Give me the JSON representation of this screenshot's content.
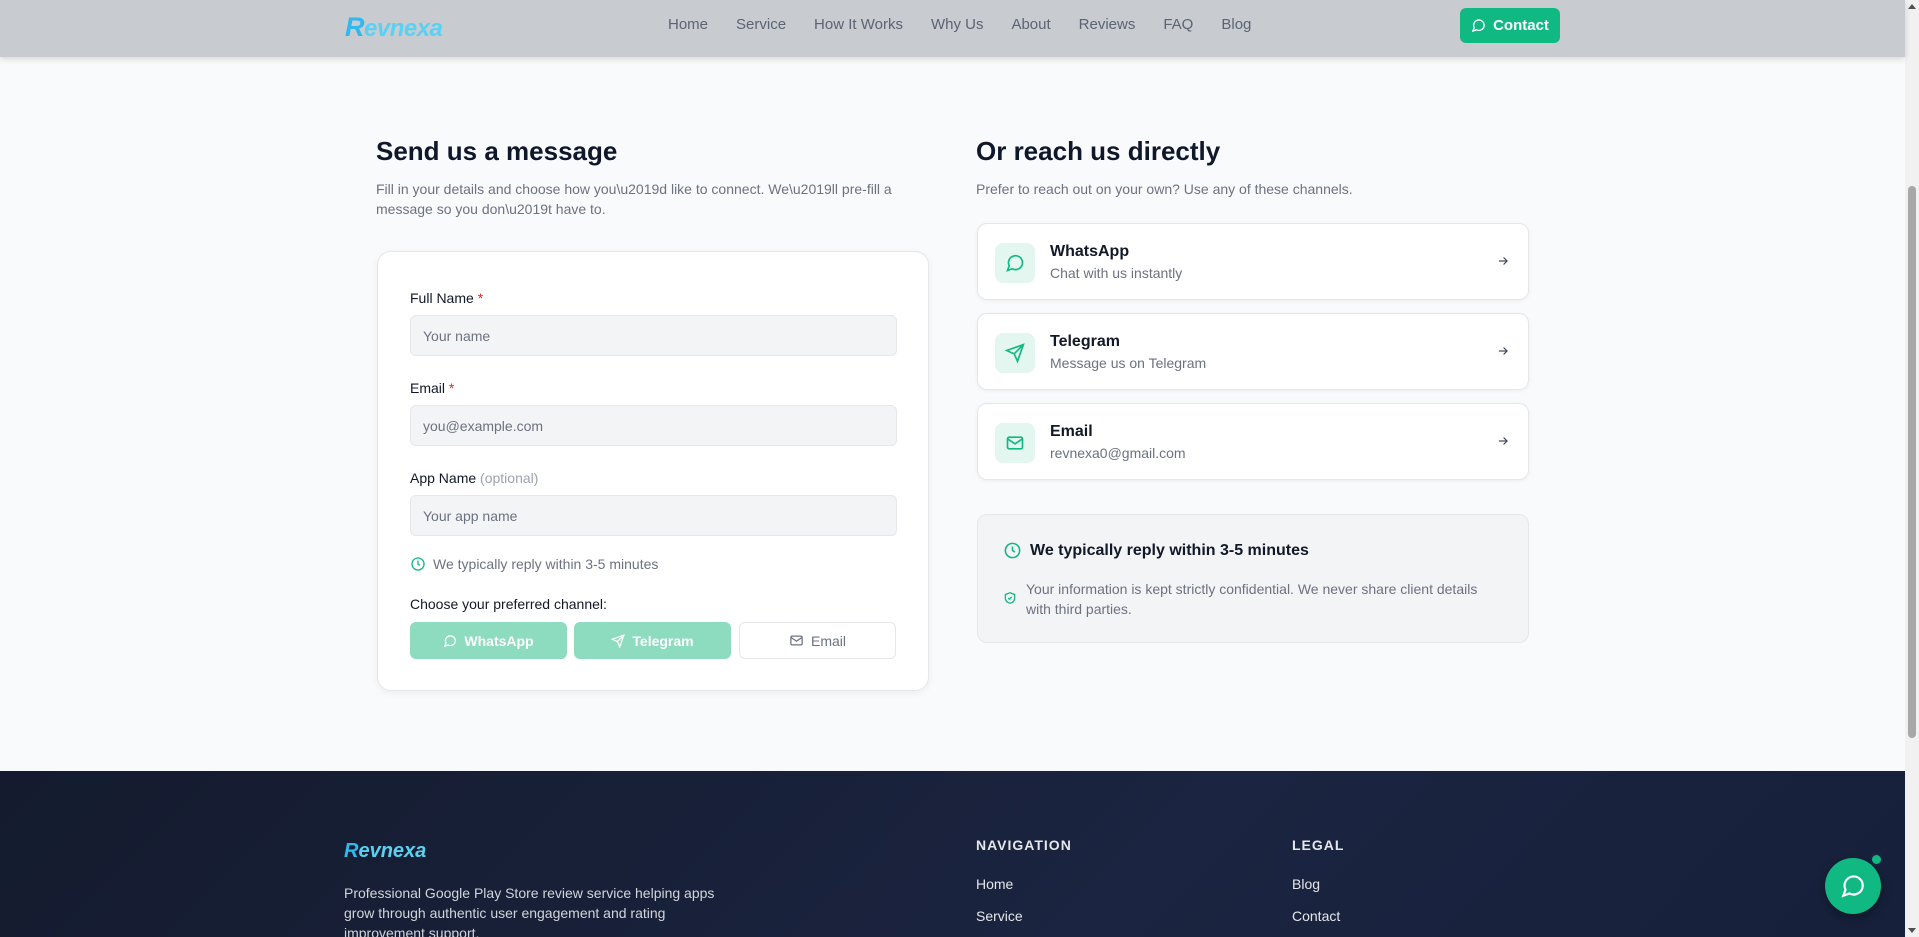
{
  "nav": {
    "logo_r": "R",
    "logo_rest": "evnexa",
    "links": [
      "Home",
      "Service",
      "How It Works",
      "Why Us",
      "About",
      "Reviews",
      "FAQ",
      "Blog"
    ],
    "contact_label": "Contact"
  },
  "form_section": {
    "title": "Send us a message",
    "subtitle_line1": "Fill in your details and choose how you\\u2019d like to connect. We\\u2019ll pre-fill a",
    "subtitle_line2": "message so you don\\u2019t have to.",
    "full_name_label": "Full Name",
    "full_name_placeholder": "Your name",
    "email_label": "Email",
    "email_placeholder": "you@example.com",
    "app_name_label": "App Name",
    "app_name_optional": "(optional)",
    "app_name_placeholder": "Your app name",
    "required_mark": "*",
    "reply_note": "We typically reply within 3-5 minutes",
    "channel_label": "Choose your preferred channel:",
    "channels": {
      "whatsapp": "WhatsApp",
      "telegram": "Telegram",
      "email": "Email"
    }
  },
  "direct_section": {
    "title": "Or reach us directly",
    "subtitle": "Prefer to reach out on your own? Use any of these channels.",
    "cards": [
      {
        "title": "WhatsApp",
        "sub": "Chat with us instantly",
        "icon": "chat-icon"
      },
      {
        "title": "Telegram",
        "sub": "Message us on Telegram",
        "icon": "send-icon"
      },
      {
        "title": "Email",
        "sub": "revnexa0@gmail.com",
        "icon": "mail-icon"
      }
    ],
    "info_title": "We typically reply within 3-5 minutes",
    "info_text": "Your information is kept strictly confidential. We never share client details with third parties."
  },
  "footer": {
    "logo_r": "R",
    "logo_rest": "evnexa",
    "description": "Professional Google Play Store review service helping apps grow through authentic user engagement and rating improvement support.",
    "nav_heading": "NAVIGATION",
    "nav_links": [
      "Home",
      "Service"
    ],
    "legal_heading": "LEGAL",
    "legal_links": [
      "Blog",
      "Contact"
    ]
  },
  "colors": {
    "accent": "#10b981",
    "accent_light": "#8ddcc0",
    "logo": "#5ad1f0"
  }
}
